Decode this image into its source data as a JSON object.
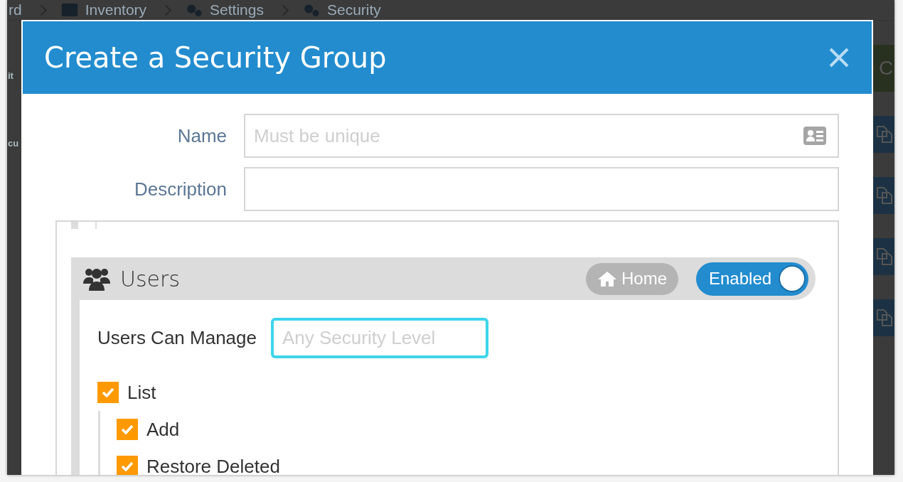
{
  "background": {
    "breadcrumb": [
      {
        "label": "rd"
      },
      {
        "label": "Inventory"
      },
      {
        "label": "Settings"
      },
      {
        "label": "Security"
      }
    ],
    "fragments": [
      "it",
      "cu"
    ],
    "action_button": "C"
  },
  "modal": {
    "title": "Create a Security Group",
    "fields": [
      {
        "label": "Name",
        "placeholder": "Must be unique",
        "kind": "contact"
      },
      {
        "label": "Description",
        "kind": "plain"
      }
    ],
    "section": {
      "title": "Users",
      "home_button": "Home",
      "toggle": {
        "label": "Enabled",
        "on": true
      },
      "manage": {
        "label": "Users Can Manage",
        "placeholder": "Any Security Level",
        "focused": true
      },
      "permissions": [
        {
          "label": "List",
          "checked": true,
          "children": [
            {
              "label": "Add",
              "checked": true
            },
            {
              "label": "Restore Deleted",
              "checked": true
            }
          ]
        }
      ]
    }
  }
}
